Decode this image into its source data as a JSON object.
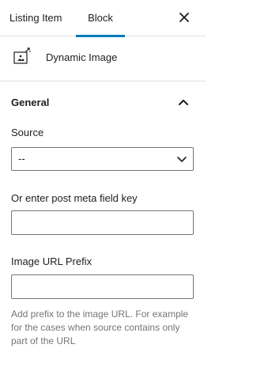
{
  "tabs": [
    {
      "label": "Listing Item",
      "active": false
    },
    {
      "label": "Block",
      "active": true
    }
  ],
  "close_icon": "close-icon",
  "block": {
    "icon": "dynamic-image-icon",
    "title": "Dynamic Image"
  },
  "section": {
    "title": "General",
    "expanded": true
  },
  "fields": {
    "source": {
      "label": "Source",
      "value": "--"
    },
    "meta_key": {
      "label": "Or enter post meta field key",
      "value": "",
      "placeholder": ""
    },
    "url_prefix": {
      "label": "Image URL Prefix",
      "value": "",
      "placeholder": ""
    }
  },
  "help_text": "Add prefix to the image URL. For example for the cases when source contains only part of the URL",
  "colors": {
    "accent": "#007cba",
    "border": "#757575",
    "help": "#757575"
  }
}
